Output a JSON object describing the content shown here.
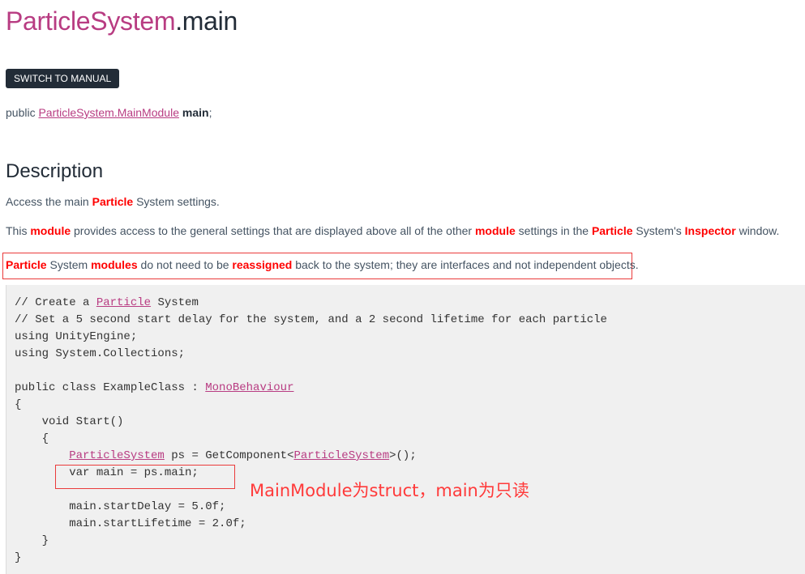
{
  "header": {
    "class_name": "ParticleSystem",
    "member_name": ".main"
  },
  "switch_button": {
    "label": "SWITCH TO MANUAL"
  },
  "declaration": {
    "prefix": "public ",
    "type_link": "ParticleSystem.MainModule",
    "space": " ",
    "name": "main",
    "suffix": ";"
  },
  "description": {
    "heading": "Description",
    "para1": {
      "t1": "Access the main ",
      "h1": "Particle",
      "t2": " System settings."
    },
    "para2": {
      "t1": "This ",
      "h1": "module",
      "t2": " provides access to the general settings that are displayed above all of the other ",
      "h2": "module",
      "t3": " settings in the ",
      "h3": "Particle",
      "t4": " System's ",
      "h4": "Inspector",
      "t5": " window."
    },
    "para3": {
      "h1": "Particle",
      "t1": " System ",
      "h2": "modules",
      "t2": " do not need to be ",
      "h3": "reassigned",
      "t3": " back to the system; they are interfaces and not independent objects."
    }
  },
  "code": {
    "l1": {
      "t1": "// Create a ",
      "link": "Particle",
      "t2": " System"
    },
    "l2": "// Set a 5 second start delay for the system, and a 2 second lifetime for each particle",
    "l3": "using UnityEngine;",
    "l4": "using System.Collections;",
    "l5": {
      "t1": "public class ExampleClass : ",
      "link": "MonoBehaviour"
    },
    "l6": "{",
    "l7": "    void Start()",
    "l8": "    {",
    "l9": {
      "indent": "        ",
      "link1": "ParticleSystem",
      "t1": " ps = GetComponent<",
      "link2": "ParticleSystem",
      "t2": ">();"
    },
    "l10": "        var main = ps.main;",
    "l11": "        main.startDelay = 5.0f;",
    "l12": "        main.startLifetime = 2.0f;",
    "l13": "    }",
    "l14": "}"
  },
  "annotation": {
    "text": "MainModule为struct，main为只读"
  },
  "colors": {
    "accent": "#b83c82",
    "highlight": "#ff0000",
    "box": "#ea3b3b",
    "code_bg": "#f0f0f0"
  }
}
